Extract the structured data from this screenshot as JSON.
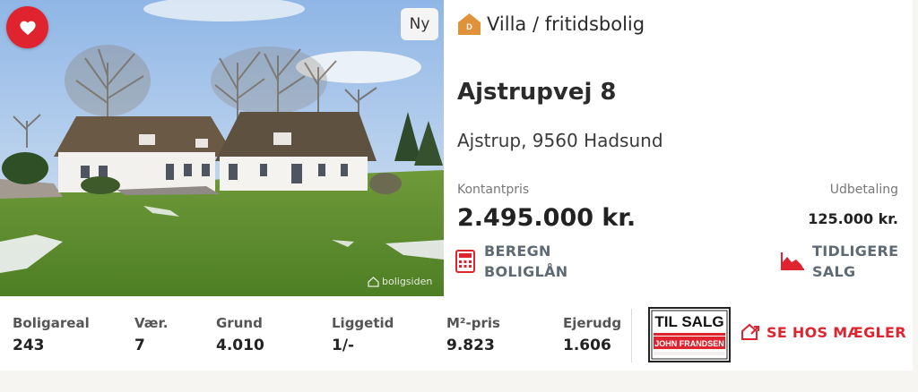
{
  "listing": {
    "badge_new": "Ny",
    "energy_label": "D",
    "property_type": "Villa / fritidsbolig",
    "street": "Ajstrupvej 8",
    "city": "Ajstrup, 9560 Hadsund",
    "price_label": "Kontantpris",
    "price": "2.495.000 kr.",
    "down_payment_label": "Udbetaling",
    "down_payment": "125.000 kr.",
    "watermark": "boligsiden"
  },
  "actions": {
    "loan_line1": "BEREGN",
    "loan_line2": "BOLIGLÅN",
    "sales_line1": "TIDLIGERE",
    "sales_line2": "SALG",
    "broker": "SE HOS MÆGLER"
  },
  "stats": [
    {
      "label": "Boligareal",
      "value": "243"
    },
    {
      "label": "Vær.",
      "value": "7"
    },
    {
      "label": "Grund",
      "value": "4.010"
    },
    {
      "label": "Liggetid",
      "value": "1/-"
    },
    {
      "label": "M²-pris",
      "value": "9.823"
    },
    {
      "label": "Ejerudg",
      "value": "1.606"
    }
  ],
  "sign": {
    "line1": "TIL SALG",
    "line2": "JOHN FRANDSEN"
  },
  "colors": {
    "accent_red": "#e0242f",
    "energy_orange": "#e0923a",
    "link_gray": "#5f6a74"
  },
  "icons": {
    "favorite": "heart-icon",
    "energy": "house-energy-icon",
    "loan": "calculator-icon",
    "sales": "area-chart-icon",
    "broker": "external-house-icon"
  }
}
